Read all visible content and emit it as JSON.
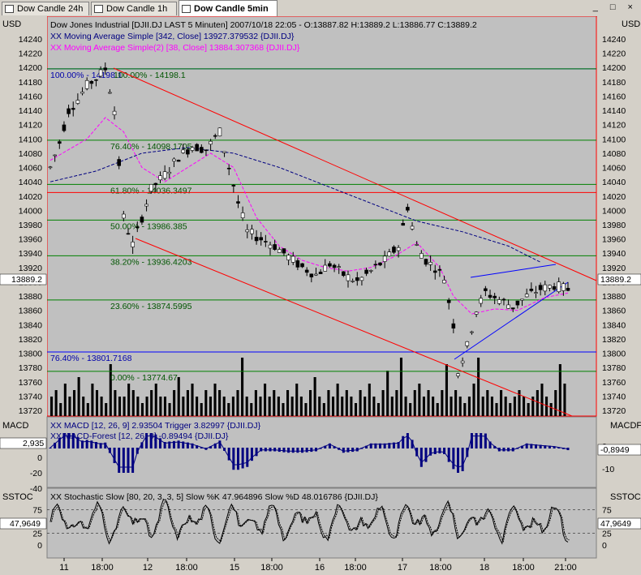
{
  "tabs": [
    {
      "label": "Dow Candle 24h",
      "active": false
    },
    {
      "label": "Dow Candle 1h",
      "active": false
    },
    {
      "label": "Dow Candle 5min",
      "active": true
    }
  ],
  "window_buttons": "_ □ ×",
  "price_panel": {
    "unit": "USD",
    "title": "Dow Jones Industrial [DJII.DJ LAST 5 Minuten] 2007/10/18 22:05 - O:13887.82 H:13889.2 L:13886.77 C:13889.2",
    "ma1_label": "XX Moving Average Simple [342, Close] 13927.379532 {DJII.DJ}",
    "ma2_label": "XX Moving Average Simple(2) [38, Close] 13884.307368 {DJII.DJ}",
    "current_price_label": "13889.2",
    "y_ticks": [
      "14240",
      "14220",
      "14200",
      "14180",
      "14160",
      "14140",
      "14120",
      "14100",
      "14080",
      "14060",
      "14040",
      "14020",
      "14000",
      "13980",
      "13960",
      "13940",
      "13920",
      "13900",
      "13880",
      "13860",
      "13840",
      "13820",
      "13800",
      "13780",
      "13760",
      "13740",
      "13720"
    ],
    "fib_levels": [
      {
        "label": "100.00% - 14198.1",
        "value": 14198.1,
        "color": "#0000aa"
      },
      {
        "label": "100.00% - 14198.1",
        "value": 14198.1,
        "color": "#005500"
      },
      {
        "label": "76.40% - 14098.1705",
        "value": 14098.1705,
        "color": "#005500"
      },
      {
        "label": "61.80% - 14036.3497",
        "value": 14036.3497,
        "color": "#005500"
      },
      {
        "label": "50.00% - 13986.385",
        "value": 13986.385,
        "color": "#005500"
      },
      {
        "label": "38.20% - 13936.4203",
        "value": 13936.4203,
        "color": "#005500"
      },
      {
        "label": "23.60% - 13874.5995",
        "value": 13874.5995,
        "color": "#005500"
      },
      {
        "label": "76.40% - 13801.7168",
        "value": 13801.7168,
        "color": "#0000aa"
      },
      {
        "label": "0.00% - 13774.67",
        "value": 13774.67,
        "color": "#005500"
      }
    ]
  },
  "macd_panel": {
    "title": "MACD",
    "title_right": "MACDF",
    "line1": "XX MACD [12, 26, 9] 2.93504 Trigger 3.82997 {DJII.DJ}",
    "line2": "XX MACD-Forest [12, 26, 9] -0.89494 {DJII.DJ}",
    "value_left": "2,935",
    "value_right": "-0,8949",
    "y_ticks_left": [
      "20",
      "0",
      "-20",
      "-40"
    ],
    "y_ticks_right": [
      "0",
      "-10"
    ]
  },
  "stoch_panel": {
    "title": "SSTOC",
    "title_right": "SSTOC",
    "line1": "XX Stochastic Slow [80, 20, 3, 3, 5] Slow %K 47.964896 Slow %D 48.016786 {DJII.DJ}",
    "value": "47,9649",
    "y_ticks": [
      "75",
      "50",
      "25",
      "0"
    ]
  },
  "x_axis": {
    "labels": [
      "11",
      "18:00",
      "12",
      "18:00",
      "15",
      "18:00",
      "16",
      "18:00",
      "17",
      "18:00",
      "18",
      "18:00",
      "21:00"
    ]
  },
  "colors": {
    "panel_bg": "#c0c0c0",
    "candle": "#000000",
    "ma1": "#000080",
    "ma2": "#ff00ff",
    "fib_green": "#008000",
    "trend_red": "#ff0000",
    "triangle_blue": "#0000ff",
    "macd_bar": "#000080"
  },
  "chart_data": {
    "type": "candlestick",
    "title": "Dow Jones Industrial [DJII.DJ LAST 5 Minuten] 2007/10/18 22:05 - O:13887.82 H:13889.2 L:13886.77 C:13889.2",
    "ylabel": "USD",
    "ylim": [
      13710,
      14250
    ],
    "x_labels": [
      "11",
      "18:00",
      "12",
      "18:00",
      "15",
      "18:00",
      "16",
      "18:00",
      "17",
      "18:00",
      "18",
      "18:00",
      "21:00"
    ],
    "price_path": [
      [
        0,
        14060
      ],
      [
        2,
        14095
      ],
      [
        4,
        14140
      ],
      [
        6,
        14155
      ],
      [
        8,
        14175
      ],
      [
        10,
        14185
      ],
      [
        12,
        14198
      ],
      [
        14,
        14140
      ],
      [
        16,
        13990
      ],
      [
        18,
        13952
      ],
      [
        20,
        13990
      ],
      [
        22,
        14030
      ],
      [
        25,
        14050
      ],
      [
        28,
        14075
      ],
      [
        31,
        14090
      ],
      [
        34,
        14085
      ],
      [
        37,
        14110
      ],
      [
        39,
        14060
      ],
      [
        41,
        14010
      ],
      [
        43,
        13970
      ],
      [
        46,
        13960
      ],
      [
        49,
        13950
      ],
      [
        52,
        13935
      ],
      [
        55,
        13920
      ],
      [
        58,
        13910
      ],
      [
        61,
        13925
      ],
      [
        64,
        13910
      ],
      [
        67,
        13900
      ],
      [
        70,
        13915
      ],
      [
        73,
        13930
      ],
      [
        76,
        13950
      ],
      [
        78,
        14005
      ],
      [
        80,
        13950
      ],
      [
        82,
        13930
      ],
      [
        84,
        13920
      ],
      [
        86,
        13905
      ],
      [
        88,
        13840
      ],
      [
        89,
        13775
      ],
      [
        91,
        13810
      ],
      [
        93,
        13860
      ],
      [
        95,
        13885
      ],
      [
        98,
        13875
      ],
      [
        101,
        13865
      ],
      [
        104,
        13880
      ],
      [
        107,
        13890
      ],
      [
        110,
        13895
      ],
      [
        113,
        13889.2
      ]
    ],
    "ma1_path": [
      [
        0,
        14040
      ],
      [
        10,
        14055
      ],
      [
        20,
        14080
      ],
      [
        30,
        14088
      ],
      [
        40,
        14080
      ],
      [
        50,
        14060
      ],
      [
        60,
        14035
      ],
      [
        70,
        14010
      ],
      [
        80,
        13985
      ],
      [
        90,
        13970
      ],
      [
        100,
        13950
      ],
      [
        107,
        13927.38
      ]
    ],
    "ma2_path": [
      [
        0,
        14070
      ],
      [
        8,
        14100
      ],
      [
        12,
        14130
      ],
      [
        16,
        14110
      ],
      [
        20,
        14060
      ],
      [
        25,
        14040
      ],
      [
        30,
        14060
      ],
      [
        35,
        14080
      ],
      [
        40,
        14060
      ],
      [
        45,
        13990
      ],
      [
        50,
        13950
      ],
      [
        55,
        13930
      ],
      [
        60,
        13920
      ],
      [
        65,
        13915
      ],
      [
        70,
        13920
      ],
      [
        75,
        13935
      ],
      [
        80,
        13955
      ],
      [
        85,
        13920
      ],
      [
        88,
        13880
      ],
      [
        92,
        13855
      ],
      [
        97,
        13862
      ],
      [
        102,
        13860
      ],
      [
        108,
        13878
      ],
      [
        113,
        13884.31
      ]
    ],
    "volume": [
      3,
      4,
      2,
      5,
      3,
      4,
      6,
      3,
      2,
      5,
      4,
      3,
      2,
      8,
      4,
      3,
      3,
      5,
      4,
      3,
      2,
      3,
      4,
      5,
      3,
      3,
      2,
      4,
      6,
      3,
      4,
      5,
      3,
      2,
      4,
      3,
      5,
      4,
      3,
      2,
      3,
      4,
      9,
      3,
      2,
      4,
      3,
      5,
      3,
      4,
      3,
      2,
      4,
      3,
      5,
      3,
      2,
      4,
      6,
      3,
      2,
      4,
      3,
      5,
      3,
      4,
      3,
      2,
      4,
      3,
      5,
      3,
      2,
      4,
      7,
      3,
      4,
      9,
      3,
      2,
      4,
      5,
      3,
      4,
      3,
      2,
      4,
      8,
      3,
      4,
      3,
      2,
      3,
      5,
      9,
      3,
      4,
      3,
      2,
      4,
      3,
      2,
      3,
      4,
      3,
      2,
      3,
      4,
      5,
      3,
      2,
      4,
      8,
      5
    ]
  }
}
